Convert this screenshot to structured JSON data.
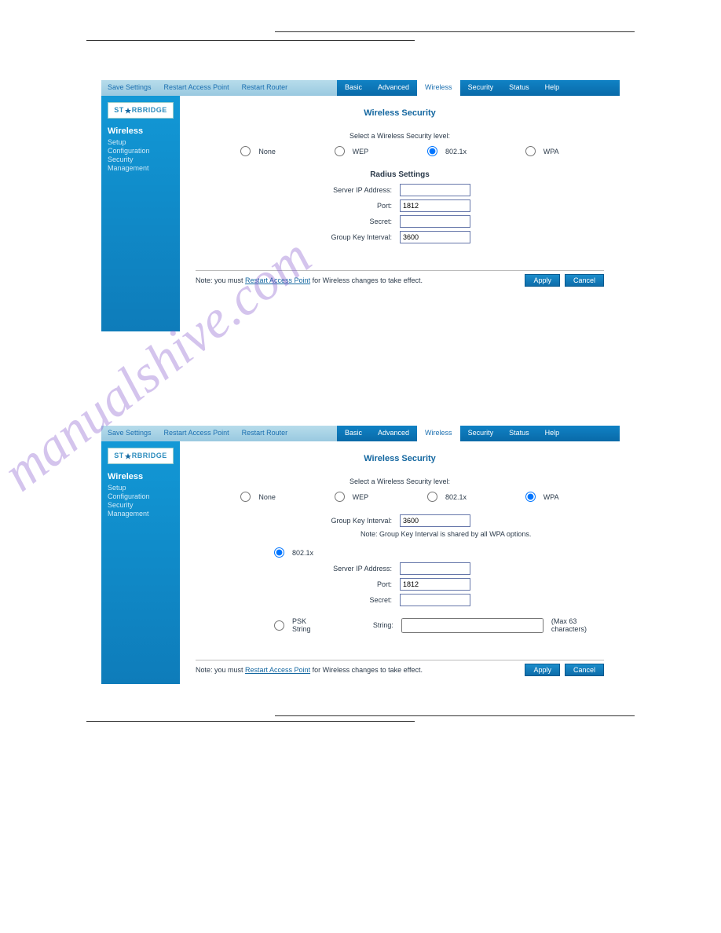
{
  "watermark": "manualshive.com",
  "topbar_left": {
    "save": "Save Settings",
    "rap": "Restart Access Point",
    "rr": "Restart Router"
  },
  "topbar_right": {
    "basic": "Basic",
    "advanced": "Advanced",
    "wireless": "Wireless",
    "security": "Security",
    "status": "Status",
    "help": "Help"
  },
  "logo": "ST★RBRIDGE",
  "sidebar": {
    "title": "Wireless",
    "items": [
      "Setup",
      "Configuration",
      "Security",
      "Management"
    ]
  },
  "s1": {
    "title": "Wireless Security",
    "subtitle": "Select a Wireless Security level:",
    "radios": {
      "none": "None",
      "wep": "WEP",
      "dot1x": "802.1x",
      "wpa": "WPA",
      "selected": "dot1x"
    },
    "section": "Radius Settings",
    "fields": {
      "ip_label": "Server IP Address:",
      "ip_val": "",
      "port_label": "Port:",
      "port_val": "1812",
      "secret_label": "Secret:",
      "secret_val": "",
      "gki_label": "Group Key Interval:",
      "gki_val": "3600"
    },
    "footer_note_pre": "Note: you must ",
    "footer_note_link": "Restart Access Point",
    "footer_note_post": " for Wireless changes to take effect.",
    "apply": "Apply",
    "cancel": "Cancel"
  },
  "s2": {
    "title": "Wireless Security",
    "subtitle": "Select a Wireless Security level:",
    "radios": {
      "none": "None",
      "wep": "WEP",
      "dot1x": "802.1x",
      "wpa": "WPA",
      "selected": "wpa"
    },
    "gki_label": "Group Key Interval:",
    "gki_val": "3600",
    "gki_note": "Note: Group Key Interval is shared by all WPA options.",
    "sub_dot1x": "802.1x",
    "ip_label": "Server IP Address:",
    "ip_val": "",
    "port_label": "Port:",
    "port_val": "1812",
    "secret_label": "Secret:",
    "secret_val": "",
    "psk_radio": "PSK String",
    "psk_label": "String:",
    "psk_val": "",
    "psk_hint": "(Max 63 characters)",
    "footer_note_pre": "Note: you must ",
    "footer_note_link": "Restart Access Point",
    "footer_note_post": " for Wireless changes to take effect.",
    "apply": "Apply",
    "cancel": "Cancel"
  }
}
